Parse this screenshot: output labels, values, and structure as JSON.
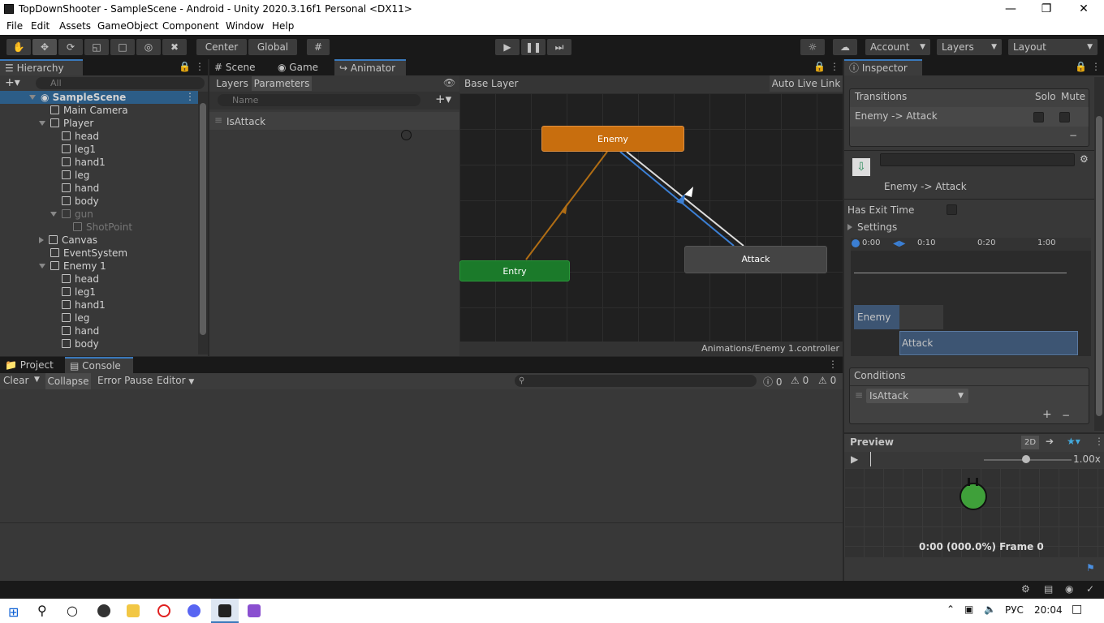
{
  "window": {
    "title": "TopDownShooter - SampleScene - Android - Unity 2020.3.16f1 Personal <DX11>"
  },
  "menu": [
    "File",
    "Edit",
    "Assets",
    "GameObject",
    "Component",
    "Window",
    "Help"
  ],
  "toolbar": {
    "center": "Center",
    "global": "Global",
    "account": "Account",
    "layers": "Layers",
    "layout": "Layout"
  },
  "hierarchy": {
    "tab": "Hierarchy",
    "search_placeholder": "All",
    "scene": "SampleScene",
    "items": [
      "Main Camera",
      "Player",
      "head",
      "leg1",
      "hand1",
      "leg",
      "hand",
      "body",
      "gun",
      "ShotPoint",
      "Canvas",
      "EventSystem",
      "Enemy 1",
      "head",
      "leg1",
      "hand1",
      "leg",
      "hand",
      "body"
    ]
  },
  "center_tabs": {
    "scene": "Scene",
    "game": "Game",
    "animator": "Animator"
  },
  "animator": {
    "layers": "Layers",
    "parameters": "Parameters",
    "name_placeholder": "Name",
    "param": "IsAttack",
    "breadcrumb": "Base Layer",
    "auto_live": "Auto Live Link",
    "footer": "Animations/Enemy 1.controller",
    "node_enemy": "Enemy",
    "node_attack": "Attack",
    "node_entry": "Entry"
  },
  "bottom": {
    "project": "Project",
    "console": "Console",
    "clear": "Clear",
    "collapse": "Collapse",
    "error_pause": "Error Pause",
    "editor": "Editor",
    "count_info": "0",
    "count_warn": "0",
    "count_err": "0"
  },
  "inspector": {
    "tab": "Inspector",
    "transitions": "Transitions",
    "solo": "Solo",
    "mute": "Mute",
    "transition_row": "Enemy -> Attack",
    "title": "Enemy -> Attack",
    "has_exit": "Has Exit Time",
    "settings": "Settings",
    "t0": "0:00",
    "t1": "0:10",
    "t2": "0:20",
    "t3": "1:00",
    "bar_enemy": "Enemy",
    "bar_attack": "Attack",
    "conditions": "Conditions",
    "cond_value": "IsAttack",
    "minus": "−",
    "plus": "+"
  },
  "preview": {
    "label": "Preview",
    "twod": "2D",
    "speed": "1.00x",
    "frame": "0:00 (000.0%) Frame 0"
  },
  "taskbar": {
    "lang": "РУС",
    "time": "20:04"
  }
}
